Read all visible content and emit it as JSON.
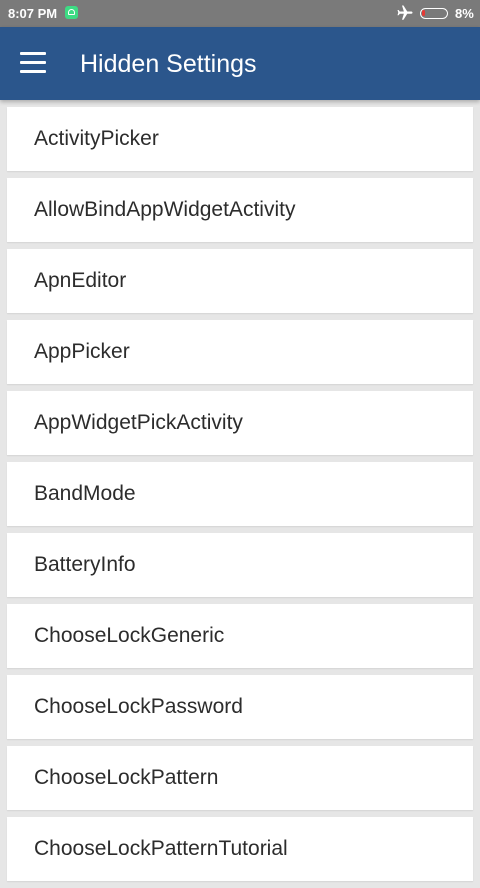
{
  "status": {
    "time": "8:07 PM",
    "battery": "8%"
  },
  "toolbar": {
    "title": "Hidden Settings"
  },
  "items": [
    "ActivityPicker",
    "AllowBindAppWidgetActivity",
    "ApnEditor",
    "AppPicker",
    "AppWidgetPickActivity",
    "BandMode",
    "BatteryInfo",
    "ChooseLockGeneric",
    "ChooseLockPassword",
    "ChooseLockPattern",
    "ChooseLockPatternTutorial"
  ]
}
